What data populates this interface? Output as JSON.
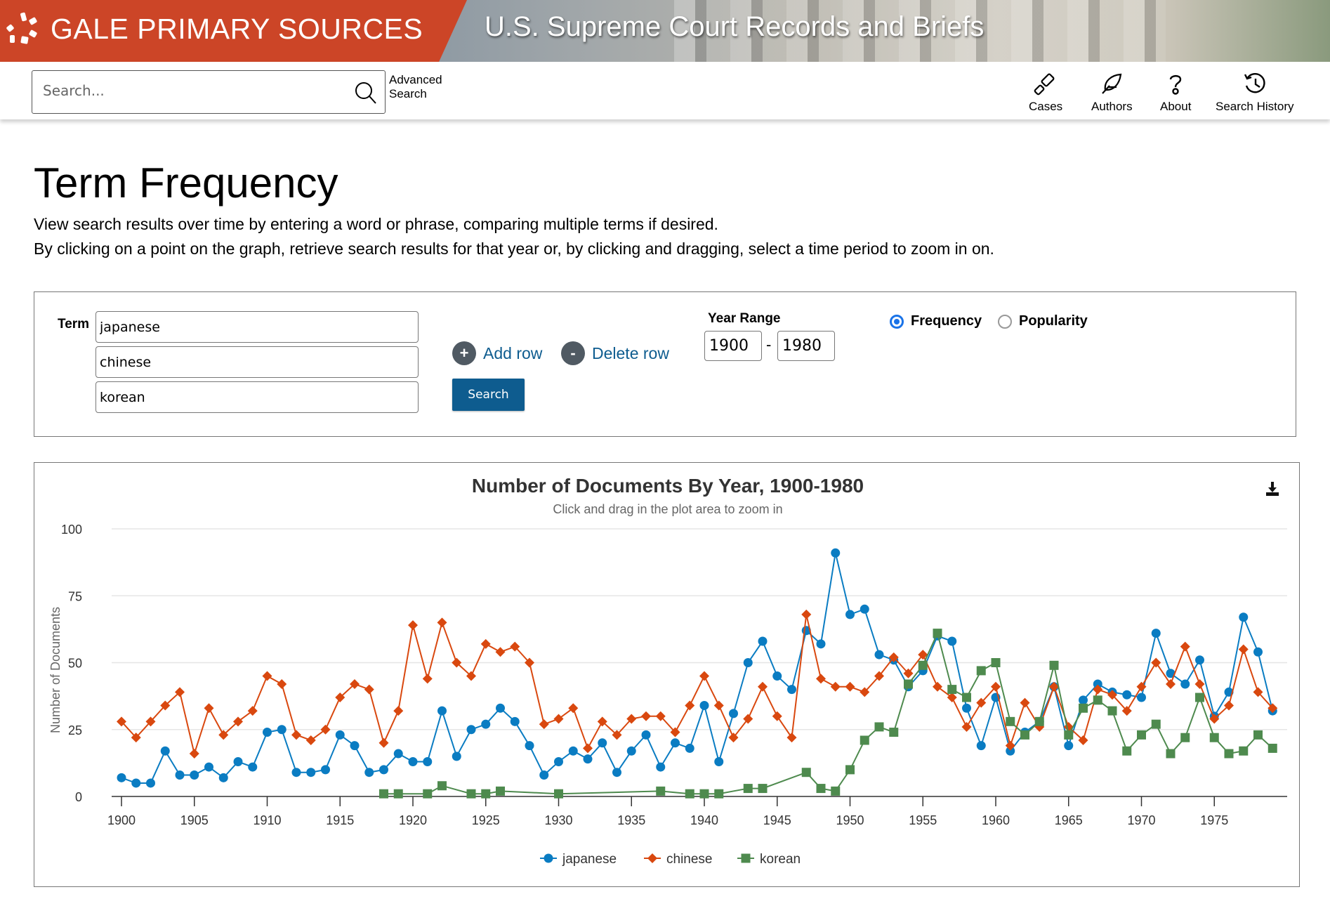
{
  "header": {
    "brand_name": "GALE PRIMARY SOURCES",
    "collection_title": "U.S. Supreme Court Records and Briefs",
    "brand_color": "#cc4527"
  },
  "topbar": {
    "search_placeholder": "Search...",
    "advanced_search_line1": "Advanced",
    "advanced_search_line2": "Search",
    "nav": [
      {
        "label": "Cases",
        "icon": "gavel-icon"
      },
      {
        "label": "Authors",
        "icon": "feather-icon"
      },
      {
        "label": "About",
        "icon": "question-icon"
      },
      {
        "label": "Search History",
        "icon": "history-icon"
      }
    ]
  },
  "page": {
    "title": "Term Frequency",
    "desc1": "View search results over time by entering a word or phrase, comparing multiple terms if desired.",
    "desc2": "By clicking on a point on the graph, retrieve search results for that year or, by clicking and dragging, select a time period to zoom in on."
  },
  "form": {
    "term_label": "Term",
    "terms": [
      "japanese",
      "chinese",
      "korean"
    ],
    "add_row": "Add row",
    "add_row_glyph": "+",
    "delete_row": "Delete row",
    "delete_row_glyph": "-",
    "search_button": "Search",
    "year_range_label": "Year Range",
    "year_from": "1900",
    "year_to": "1980",
    "year_dash": "-",
    "mode_options": [
      {
        "label": "Frequency",
        "selected": true
      },
      {
        "label": "Popularity",
        "selected": false
      }
    ],
    "accent_color": "#0e5c8f"
  },
  "chart_data": {
    "type": "line",
    "title": "Number of Documents By Year, 1900-1980",
    "subtitle": "Click and drag in the plot area to zoom in",
    "xlabel": "",
    "ylabel": "Number of Documents",
    "xlim": [
      1899.3,
      1980
    ],
    "ylim": [
      0,
      100
    ],
    "yticks": [
      0,
      25,
      50,
      75,
      100
    ],
    "xticks": [
      1900,
      1905,
      1910,
      1915,
      1920,
      1925,
      1930,
      1935,
      1940,
      1945,
      1950,
      1955,
      1960,
      1965,
      1970,
      1975
    ],
    "grid": true,
    "legend": "bottom-center",
    "download_icon": "download-icon",
    "series": [
      {
        "name": "japanese",
        "color": "#0a7cc2",
        "marker": "circle",
        "points": [
          [
            1900,
            7
          ],
          [
            1901,
            5
          ],
          [
            1902,
            5
          ],
          [
            1903,
            17
          ],
          [
            1904,
            8
          ],
          [
            1905,
            8
          ],
          [
            1906,
            11
          ],
          [
            1907,
            7
          ],
          [
            1908,
            13
          ],
          [
            1909,
            11
          ],
          [
            1910,
            24
          ],
          [
            1911,
            25
          ],
          [
            1912,
            9
          ],
          [
            1913,
            9
          ],
          [
            1914,
            10
          ],
          [
            1915,
            23
          ],
          [
            1916,
            19
          ],
          [
            1917,
            9
          ],
          [
            1918,
            10
          ],
          [
            1919,
            16
          ],
          [
            1920,
            13
          ],
          [
            1921,
            13
          ],
          [
            1922,
            32
          ],
          [
            1923,
            15
          ],
          [
            1924,
            25
          ],
          [
            1925,
            27
          ],
          [
            1926,
            33
          ],
          [
            1927,
            28
          ],
          [
            1928,
            19
          ],
          [
            1929,
            8
          ],
          [
            1930,
            13
          ],
          [
            1931,
            17
          ],
          [
            1932,
            14
          ],
          [
            1933,
            20
          ],
          [
            1934,
            9
          ],
          [
            1935,
            17
          ],
          [
            1936,
            23
          ],
          [
            1937,
            11
          ],
          [
            1938,
            20
          ],
          [
            1939,
            18
          ],
          [
            1940,
            34
          ],
          [
            1941,
            13
          ],
          [
            1942,
            31
          ],
          [
            1943,
            50
          ],
          [
            1944,
            58
          ],
          [
            1945,
            45
          ],
          [
            1946,
            40
          ],
          [
            1947,
            62
          ],
          [
            1948,
            57
          ],
          [
            1949,
            91
          ],
          [
            1950,
            68
          ],
          [
            1951,
            70
          ],
          [
            1952,
            53
          ],
          [
            1953,
            51
          ],
          [
            1954,
            41
          ],
          [
            1955,
            47
          ],
          [
            1956,
            60
          ],
          [
            1957,
            58
          ],
          [
            1958,
            33
          ],
          [
            1959,
            19
          ],
          [
            1960,
            37
          ],
          [
            1961,
            17
          ],
          [
            1962,
            24
          ],
          [
            1963,
            28
          ],
          [
            1964,
            41
          ],
          [
            1965,
            19
          ],
          [
            1966,
            36
          ],
          [
            1967,
            42
          ],
          [
            1968,
            39
          ],
          [
            1969,
            38
          ],
          [
            1970,
            37
          ],
          [
            1971,
            61
          ],
          [
            1972,
            46
          ],
          [
            1973,
            42
          ],
          [
            1974,
            51
          ],
          [
            1975,
            30
          ],
          [
            1976,
            39
          ],
          [
            1977,
            67
          ],
          [
            1978,
            54
          ],
          [
            1979,
            32
          ]
        ]
      },
      {
        "name": "chinese",
        "color": "#d9480f",
        "marker": "diamond",
        "points": [
          [
            1900,
            28
          ],
          [
            1901,
            22
          ],
          [
            1902,
            28
          ],
          [
            1903,
            34
          ],
          [
            1904,
            39
          ],
          [
            1905,
            16
          ],
          [
            1906,
            33
          ],
          [
            1907,
            23
          ],
          [
            1908,
            28
          ],
          [
            1909,
            32
          ],
          [
            1910,
            45
          ],
          [
            1911,
            42
          ],
          [
            1912,
            23
          ],
          [
            1913,
            21
          ],
          [
            1914,
            25
          ],
          [
            1915,
            37
          ],
          [
            1916,
            42
          ],
          [
            1917,
            40
          ],
          [
            1918,
            20
          ],
          [
            1919,
            32
          ],
          [
            1920,
            64
          ],
          [
            1921,
            44
          ],
          [
            1922,
            65
          ],
          [
            1923,
            50
          ],
          [
            1924,
            45
          ],
          [
            1925,
            57
          ],
          [
            1926,
            54
          ],
          [
            1927,
            56
          ],
          [
            1928,
            50
          ],
          [
            1929,
            27
          ],
          [
            1930,
            29
          ],
          [
            1931,
            33
          ],
          [
            1932,
            18
          ],
          [
            1933,
            28
          ],
          [
            1934,
            23
          ],
          [
            1935,
            29
          ],
          [
            1936,
            30
          ],
          [
            1937,
            30
          ],
          [
            1938,
            24
          ],
          [
            1939,
            34
          ],
          [
            1940,
            45
          ],
          [
            1941,
            34
          ],
          [
            1942,
            22
          ],
          [
            1943,
            29
          ],
          [
            1944,
            41
          ],
          [
            1945,
            30
          ],
          [
            1946,
            22
          ],
          [
            1947,
            68
          ],
          [
            1948,
            44
          ],
          [
            1949,
            41
          ],
          [
            1950,
            41
          ],
          [
            1951,
            39
          ],
          [
            1952,
            45
          ],
          [
            1953,
            52
          ],
          [
            1954,
            46
          ],
          [
            1955,
            53
          ],
          [
            1956,
            41
          ],
          [
            1957,
            37
          ],
          [
            1958,
            26
          ],
          [
            1959,
            35
          ],
          [
            1960,
            41
          ],
          [
            1961,
            19
          ],
          [
            1962,
            35
          ],
          [
            1963,
            26
          ],
          [
            1964,
            41
          ],
          [
            1965,
            26
          ],
          [
            1966,
            21
          ],
          [
            1967,
            40
          ],
          [
            1968,
            38
          ],
          [
            1969,
            32
          ],
          [
            1970,
            41
          ],
          [
            1971,
            50
          ],
          [
            1972,
            42
          ],
          [
            1973,
            56
          ],
          [
            1974,
            42
          ],
          [
            1975,
            29
          ],
          [
            1976,
            34
          ],
          [
            1977,
            55
          ],
          [
            1978,
            39
          ],
          [
            1979,
            33
          ]
        ]
      },
      {
        "name": "korean",
        "color": "#4e8a4e",
        "marker": "square",
        "points": [
          [
            1918,
            1
          ],
          [
            1919,
            1
          ],
          [
            1921,
            1
          ],
          [
            1922,
            4
          ],
          [
            1924,
            1
          ],
          [
            1925,
            1
          ],
          [
            1926,
            2
          ],
          [
            1930,
            1
          ],
          [
            1937,
            2
          ],
          [
            1939,
            1
          ],
          [
            1940,
            1
          ],
          [
            1941,
            1
          ],
          [
            1943,
            3
          ],
          [
            1944,
            3
          ],
          [
            1947,
            9
          ],
          [
            1948,
            3
          ],
          [
            1949,
            2
          ],
          [
            1950,
            10
          ],
          [
            1951,
            21
          ],
          [
            1952,
            26
          ],
          [
            1953,
            24
          ],
          [
            1954,
            42
          ],
          [
            1955,
            49
          ],
          [
            1956,
            61
          ],
          [
            1957,
            40
          ],
          [
            1958,
            37
          ],
          [
            1959,
            47
          ],
          [
            1960,
            50
          ],
          [
            1961,
            28
          ],
          [
            1962,
            23
          ],
          [
            1963,
            28
          ],
          [
            1964,
            49
          ],
          [
            1965,
            23
          ],
          [
            1966,
            33
          ],
          [
            1967,
            36
          ],
          [
            1968,
            32
          ],
          [
            1969,
            17
          ],
          [
            1970,
            23
          ],
          [
            1971,
            27
          ],
          [
            1972,
            16
          ],
          [
            1973,
            22
          ],
          [
            1974,
            37
          ],
          [
            1975,
            22
          ],
          [
            1976,
            16
          ],
          [
            1977,
            17
          ],
          [
            1978,
            23
          ],
          [
            1979,
            18
          ]
        ]
      }
    ]
  }
}
